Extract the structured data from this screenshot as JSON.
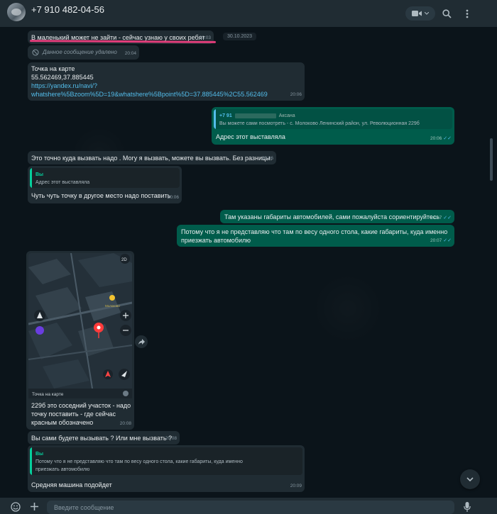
{
  "header": {
    "contact_name": "+7 910 482-04-56",
    "video_icon": "video-camera-icon",
    "search_icon": "search-icon",
    "menu_icon": "kebab-menu-icon"
  },
  "date_chip": "30.10.2023",
  "messages": [
    {
      "type": "in",
      "text": "В маленький может не зайти - сейчас узнаю у своих ребят",
      "time": "20:03"
    },
    {
      "type": "in",
      "text": "Данное сообщение удалено",
      "time": "20:04"
    },
    {
      "type": "in",
      "lines": [
        "Точка на карте",
        "55.562469,37.885445"
      ],
      "link_lines": [
        "https://yandex.ru/navi/?",
        "whatshere%5Bzoom%5D=19&whatshere%5Bpoint%5D=37.885445%2C55.562469"
      ],
      "time": "20:06"
    },
    {
      "type": "out",
      "quote_author": "+7 91",
      "quote_author_suffix": "Аксана",
      "quote_text": "Вы можете сами посмотреть - с. Молоково Ленинский район, ул. Революционная 229б",
      "text": "Адрес этот выставляла",
      "time": "20:06"
    },
    {
      "type": "in",
      "text": "Это точно куда вызвать надо . Могу я вызвать, можете вы вызвать. Без разницы.",
      "time": "20:06"
    },
    {
      "type": "in",
      "quote_author": "Вы",
      "quote_text": "Адрес этот выставляла",
      "text": "Чуть чуть точку в другое место надо поставить",
      "time": "20:06"
    },
    {
      "type": "out",
      "text": "Там указаны габариты автомобилей, сами пожалуйста сориентируйтесь",
      "time": "20:07"
    },
    {
      "type": "out",
      "lines": [
        "Потому что я не представляю что там по весу одного стола,  какие габариты, куда именно",
        "приезжать автомобилю"
      ],
      "time": "20:07"
    },
    {
      "type": "in",
      "map_caption": "Точка на карте",
      "map_badge": "2D",
      "map_street": "Молоково",
      "lines": [
        "229б это соседний участок - надо",
        "точку поставить - где сейчас",
        "красным обозначено"
      ],
      "time": "20:08"
    },
    {
      "type": "in",
      "text": "Вы сами будете вызывать ? Или мне вызвать ?",
      "time": "20:08"
    },
    {
      "type": "in",
      "quote_author": "Вы",
      "quote_lines": [
        "Потому что я не представляю что там по весу одного стола,  какие габариты, куда именно",
        "приезжать автомобилю"
      ],
      "text": "Средняя машина подойдет",
      "time": "20:09"
    }
  ],
  "footer": {
    "placeholder": "Введите сообщение",
    "emoji_icon": "emoji-icon",
    "attach_icon": "plus-icon",
    "mic_icon": "microphone-icon"
  },
  "colors": {
    "background": "#0b141a",
    "incoming": "#202c33",
    "outgoing": "#005c4b",
    "link": "#53bdeb",
    "quote_accent": "#06cf9c",
    "highlight_mark": "#e23d7a"
  }
}
